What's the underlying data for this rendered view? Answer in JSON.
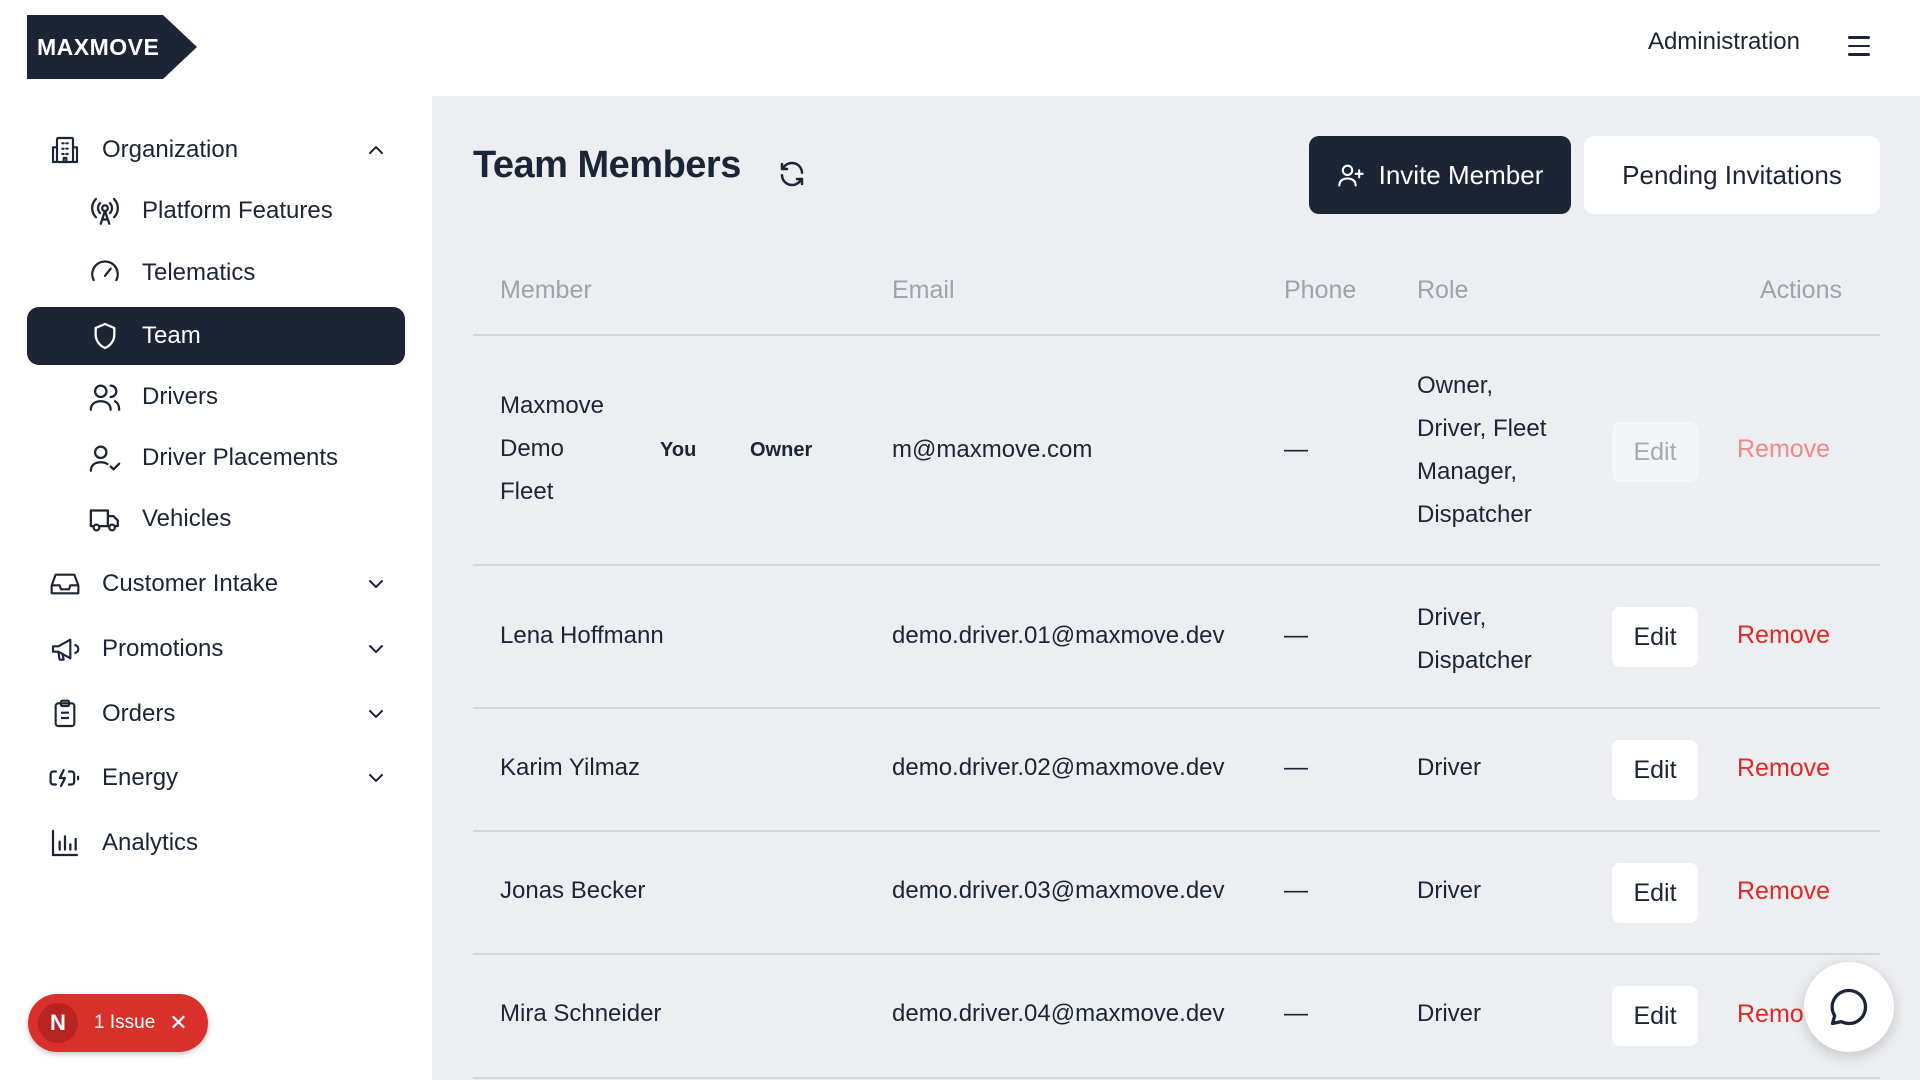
{
  "header": {
    "logo_text": "MAXMOVE",
    "admin_label": "Administration"
  },
  "sidebar": {
    "items": [
      {
        "label": "Organization",
        "icon": "building-icon",
        "expanded": true
      },
      {
        "label": "Platform Features",
        "icon": "broadcast-icon"
      },
      {
        "label": "Telematics",
        "icon": "gauge-icon"
      },
      {
        "label": "Team",
        "icon": "shield-icon",
        "active": true
      },
      {
        "label": "Drivers",
        "icon": "users-icon"
      },
      {
        "label": "Driver Placements",
        "icon": "user-check-icon"
      },
      {
        "label": "Vehicles",
        "icon": "truck-icon"
      },
      {
        "label": "Customer Intake",
        "icon": "inbox-icon",
        "expanded": false
      },
      {
        "label": "Promotions",
        "icon": "megaphone-icon",
        "expanded": false
      },
      {
        "label": "Orders",
        "icon": "clipboard-icon",
        "expanded": false
      },
      {
        "label": "Energy",
        "icon": "battery-charging-icon",
        "expanded": false
      },
      {
        "label": "Analytics",
        "icon": "bar-chart-icon"
      }
    ]
  },
  "issue": {
    "avatar_letter": "N",
    "label": "1 Issue"
  },
  "main": {
    "title": "Team Members",
    "invite_label": "Invite Member",
    "pending_label": "Pending Invitations",
    "columns": [
      "Member",
      "Email",
      "Phone",
      "Role",
      "Actions"
    ],
    "rows": [
      {
        "name_lines": [
          "Maxmove",
          "Demo",
          "Fleet"
        ],
        "badge_you": "You",
        "badge_owner": "Owner",
        "email": "m@maxmove.com",
        "phone": "—",
        "role_lines": [
          "Owner,",
          "Driver, Fleet",
          "Manager,",
          "Dispatcher"
        ],
        "edit": "Edit",
        "remove": "Remove",
        "disabled": true
      },
      {
        "name": "Lena Hoffmann",
        "email": "demo.driver.01@maxmove.dev",
        "phone": "—",
        "role_lines": [
          "Driver,",
          "Dispatcher"
        ],
        "edit": "Edit",
        "remove": "Remove"
      },
      {
        "name": "Karim Yilmaz",
        "email": "demo.driver.02@maxmove.dev",
        "phone": "—",
        "role": "Driver",
        "edit": "Edit",
        "remove": "Remove"
      },
      {
        "name": "Jonas Becker",
        "email": "demo.driver.03@maxmove.dev",
        "phone": "—",
        "role": "Driver",
        "edit": "Edit",
        "remove": "Remove"
      },
      {
        "name": "Mira Schneider",
        "email": "demo.driver.04@maxmove.dev",
        "phone": "—",
        "role": "Driver",
        "edit": "Edit",
        "remove": "Remo"
      }
    ]
  },
  "colors": {
    "navy": "#1b2536",
    "danger": "#e32727",
    "main_bg": "#eceef1"
  }
}
